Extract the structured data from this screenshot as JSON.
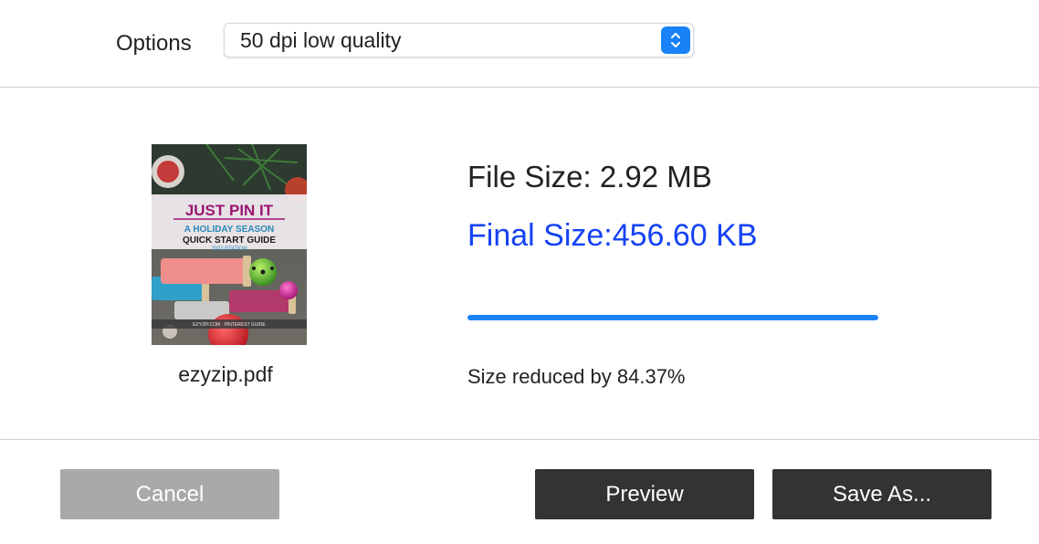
{
  "options": {
    "label": "Options",
    "selected": "50 dpi low quality"
  },
  "file": {
    "name": "ezyzip.pdf",
    "thumbnail": {
      "title": "JUST PIN IT",
      "subtitle_line1": "A HOLIDAY SEASON",
      "subtitle_line2": "QUICK START GUIDE",
      "edition": "2021 EDITION",
      "footer": "EZYZIP.COM · PINTEREST GUIDE"
    }
  },
  "stats": {
    "file_size": "File Size: 2.92 MB",
    "final_size": "Final Size:456.60 KB",
    "reduced": "Size reduced by 84.37%",
    "progress": 1.0
  },
  "buttons": {
    "cancel": "Cancel",
    "preview": "Preview",
    "save_as": "Save As..."
  },
  "colors": {
    "accent": "#1a82f7",
    "final_size_text": "#1442f5",
    "button_dark": "#333333",
    "button_disabled": "#a9a9a9"
  }
}
